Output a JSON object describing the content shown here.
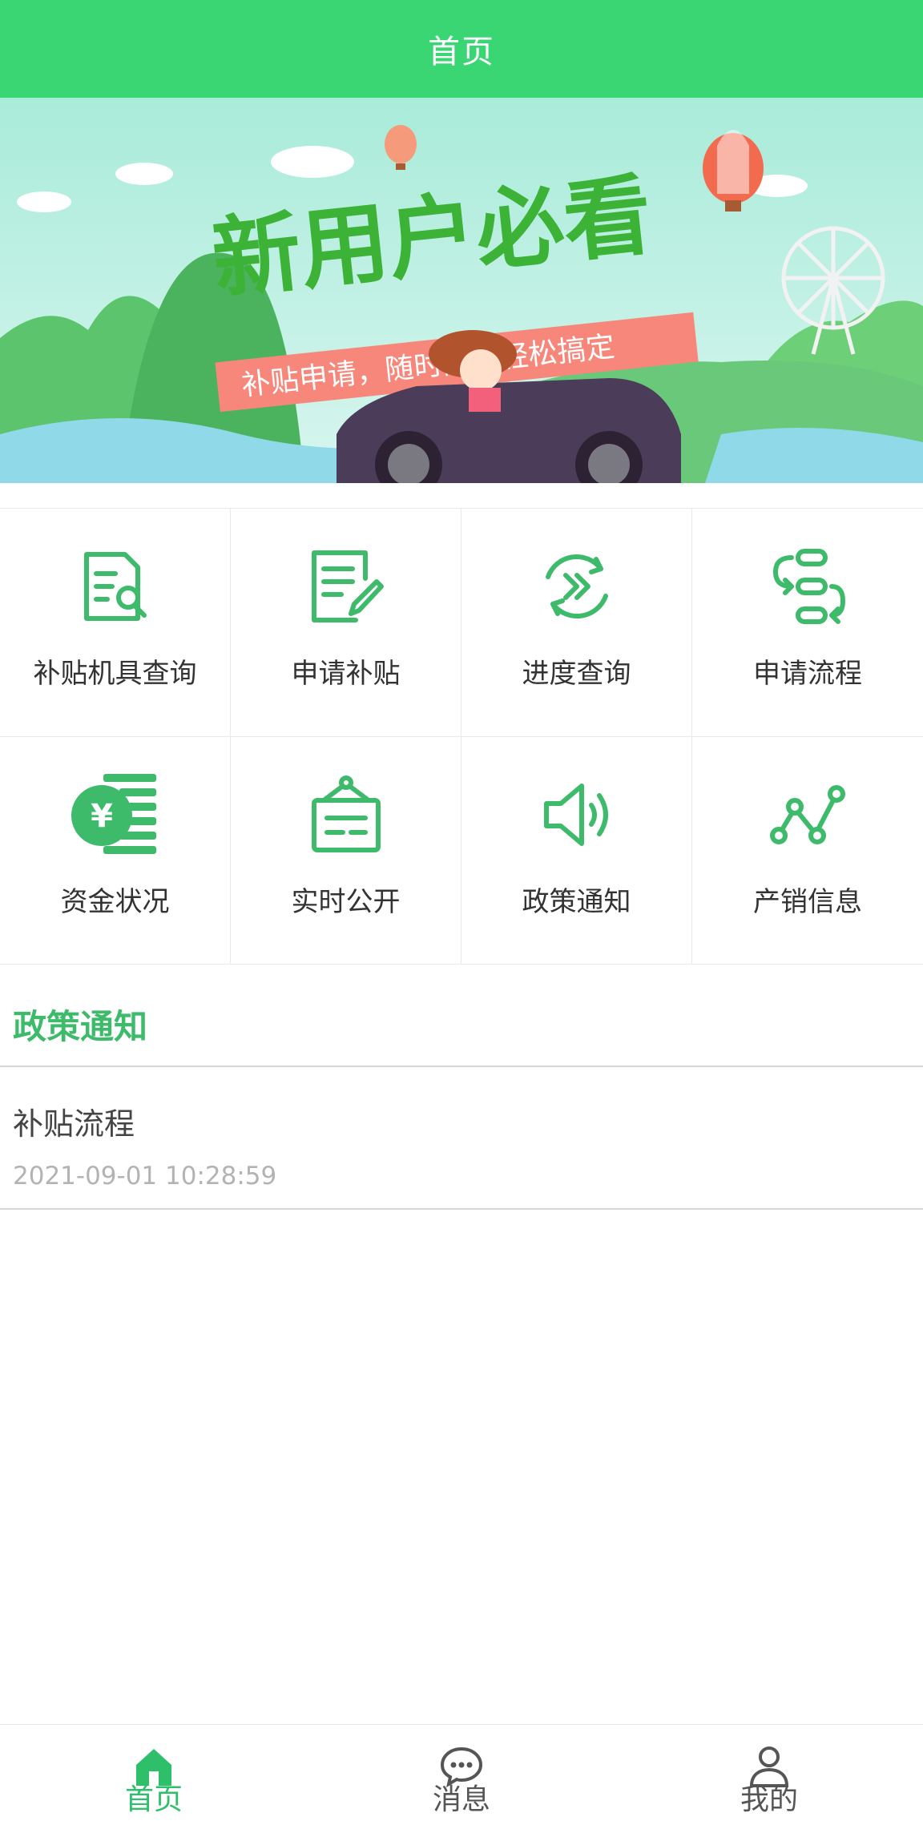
{
  "header": {
    "title": "首页"
  },
  "banner": {
    "headline": "新用户必看",
    "subline": "补贴申请，随时随地轻松搞定"
  },
  "grid": {
    "items": [
      {
        "label": "补贴机具查询",
        "icon": "document-search-icon"
      },
      {
        "label": "申请补贴",
        "icon": "edit-document-icon"
      },
      {
        "label": "进度查询",
        "icon": "progress-forward-icon"
      },
      {
        "label": "申请流程",
        "icon": "process-flow-icon"
      },
      {
        "label": "资金状况",
        "icon": "yuan-coins-icon"
      },
      {
        "label": "实时公开",
        "icon": "notice-board-icon"
      },
      {
        "label": "政策通知",
        "icon": "speaker-icon"
      },
      {
        "label": "产销信息",
        "icon": "line-trend-icon"
      }
    ]
  },
  "notices": {
    "title": "政策通知",
    "items": [
      {
        "title": "补贴流程",
        "time": "2021-09-01 10:28:59"
      }
    ]
  },
  "tabbar": {
    "items": [
      {
        "label": "首页",
        "icon": "home-icon",
        "active": true
      },
      {
        "label": "消息",
        "icon": "chat-bubble-icon",
        "active": false
      },
      {
        "label": "我的",
        "icon": "user-icon",
        "active": false
      }
    ]
  },
  "colors": {
    "brand": "#3ad673",
    "accent": "#3dbb6b",
    "muted": "#b3b3b3"
  }
}
